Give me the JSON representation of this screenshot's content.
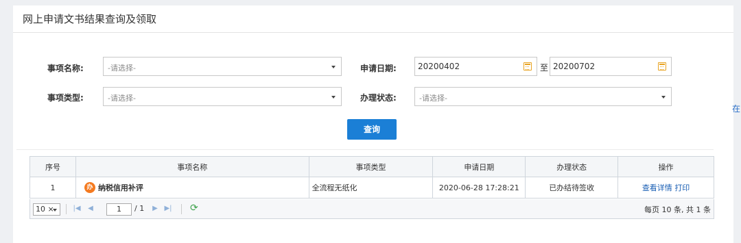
{
  "panel": {
    "title": "网上申请文书结果查询及领取"
  },
  "side_link": "在",
  "form": {
    "item_name": {
      "label": "事项名称:",
      "placeholder": "-请选择-"
    },
    "item_type": {
      "label": "事项类型:",
      "placeholder": "-请选择-"
    },
    "apply_date": {
      "label": "申请日期:",
      "start": "20200402",
      "to": "至",
      "end": "20200702"
    },
    "status": {
      "label": "办理状态:",
      "placeholder": "-请选择-"
    },
    "query_label": "查询"
  },
  "table": {
    "headers": [
      "序号",
      "事项名称",
      "事项类型",
      "申请日期",
      "办理状态",
      "操作"
    ],
    "rows": [
      {
        "index": "1",
        "badge": "办",
        "name": "纳税信用补评",
        "type": "全流程无纸化",
        "date": "2020-06-28 17:28:21",
        "status": "已办结待签收",
        "action_detail": "查看详情",
        "action_print": "打印"
      }
    ]
  },
  "pager": {
    "page_size": "10 ×",
    "page": "1",
    "total_pages": "/ 1",
    "summary": "每页 10 条, 共 1 条"
  },
  "colors": {
    "accent": "#1b7fd6",
    "badge": "#f47a20",
    "calendar": "#e8a321",
    "link": "#1a5fb4"
  }
}
